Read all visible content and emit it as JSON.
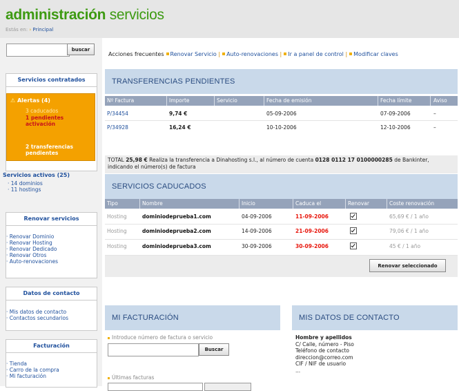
{
  "header": {
    "title_bold": "administración",
    "title_rest": " servicios",
    "breadcrumb_prefix": "Estás en:",
    "breadcrumb_link": "Principal"
  },
  "search": {
    "button": "buscar",
    "value": ""
  },
  "sidebar": {
    "contracted": {
      "heading": "Servicios contratados",
      "alerts_title": "Alertas (4)",
      "alerts": [
        "3 caducados",
        "1 pendientes activación",
        "2 transferencias pendientes"
      ]
    },
    "active": {
      "heading": "Servicios activos (25)",
      "items": [
        "14 dominios",
        "11 hostings"
      ]
    },
    "renew": {
      "heading": "Renovar servicios",
      "items": [
        "Renovar Dominio",
        "Renovar Hosting",
        "Renovar Dedicado",
        "Renovar Otros",
        "Auto-renovaciones"
      ]
    },
    "contact": {
      "heading": "Datos de contacto",
      "items": [
        "Mis datos de contacto",
        "Contactos secundarios"
      ]
    },
    "billing": {
      "heading": "Facturación",
      "items": [
        "Tienda",
        "Carro de la compra",
        "Mi facturación"
      ]
    }
  },
  "quick_actions": {
    "label": "Acciones frecuentes",
    "items": [
      "Renovar Servicio",
      "Auto-renovaciones",
      "Ir a panel de control",
      "Modificar claves"
    ]
  },
  "transfers": {
    "title": "TRANSFERENCIAS PENDIENTES",
    "columns": [
      "Nº Factura",
      "Importe",
      "Servicio",
      "Fecha de emisión",
      "Fecha límite",
      "Aviso"
    ],
    "rows": [
      {
        "invoice": "P/34454",
        "amount": "9,74 €",
        "service": "",
        "issued": "05-09-2006",
        "due": "07-09-2006",
        "notice": "–"
      },
      {
        "invoice": "P/34928",
        "amount": "16,24 €",
        "service": "",
        "issued": "10-10-2006",
        "due": "12-10-2006",
        "notice": "–"
      }
    ],
    "total_label": "TOTAL",
    "total_amount": "25,98 €",
    "total_text_1": "Realiza la transferencia a Dinahosting s.l., al número de cuenta",
    "account": "0128 0112 17 0100000285",
    "total_text_2": "de Bankinter,",
    "total_text_3": "indicando el número(s) de factura"
  },
  "expired": {
    "title": "SERVICIOS CADUCADOS",
    "columns": [
      "Tipo",
      "Nombre",
      "Inicio",
      "Caduca el",
      "Renovar",
      "Coste renovación"
    ],
    "rows": [
      {
        "type": "Hosting",
        "name": "dominiodeprueba1.com",
        "start": "04-09-2006",
        "expires": "11-09-2006",
        "cost": "65,69 € / 1 año"
      },
      {
        "type": "Hosting",
        "name": "dominiodeprueba2.com",
        "start": "14-09-2006",
        "expires": "21-09-2006",
        "cost": "79,06 € / 1 año"
      },
      {
        "type": "Hosting",
        "name": "dominiodeprueba3.com",
        "start": "30-09-2006",
        "expires": "30-09-2006",
        "cost": "45 € / 1 año"
      }
    ],
    "renew_button": "Renovar seleccionado"
  },
  "billing_panel": {
    "title": "MI FACTURACIÓN",
    "search_label": "Introduce número de factura o servicio",
    "search_button": "Buscar",
    "recent_label": "Últimas facturas"
  },
  "contact_panel": {
    "title": "MIS DATOS DE CONTACTO",
    "name": "Hombre y apellidos",
    "lines": [
      "C/ Calle, número - Piso",
      "Teléfono de contacto",
      "direccion@correo.com",
      "CIF / NIF de usuario",
      "..."
    ]
  },
  "colors": {
    "brand_green": "#3d9a12",
    "link_blue": "#1e4f9c",
    "alert_orange": "#f4a100",
    "expired_red": "#e8160c",
    "panel_blue": "#c9d9ea",
    "header_gray": "#95a3ba"
  }
}
